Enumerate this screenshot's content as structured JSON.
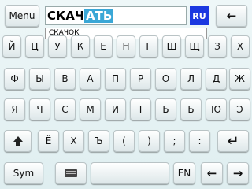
{
  "input": {
    "typed": "СКАЧ",
    "completion": "АТЬ"
  },
  "language_indicator": "RU",
  "suggestion": "СКАЧОК",
  "top_bar": {
    "menu": "Menu",
    "backspace_icon": "arrow-left-icon"
  },
  "rows": [
    [
      "Й",
      "Ц",
      "У",
      "К",
      "Е",
      "Н",
      "Г",
      "Ш",
      "Щ",
      "З",
      "Х"
    ],
    [
      "Ф",
      "Ы",
      "В",
      "А",
      "П",
      "Р",
      "О",
      "Л",
      "Д",
      "Ж"
    ],
    [
      "Я",
      "Ч",
      "С",
      "М",
      "И",
      "Т",
      "Ь",
      "Б",
      "Ю",
      "Э"
    ]
  ],
  "row4": {
    "shift_icon": "shift-icon",
    "keys": [
      "Ё",
      "Х",
      "Ъ",
      "(",
      ")",
      ";",
      ":"
    ],
    "enter_icon": "enter-icon"
  },
  "bottom_row": {
    "sym": "Sym",
    "keyboard_icon": "keyboard-icon",
    "lang": "EN",
    "left_icon": "arrow-left-icon",
    "right_icon": "arrow-right-icon"
  },
  "colors": {
    "accent": "#3aa7d6",
    "lang_bg": "#1b38e0"
  }
}
